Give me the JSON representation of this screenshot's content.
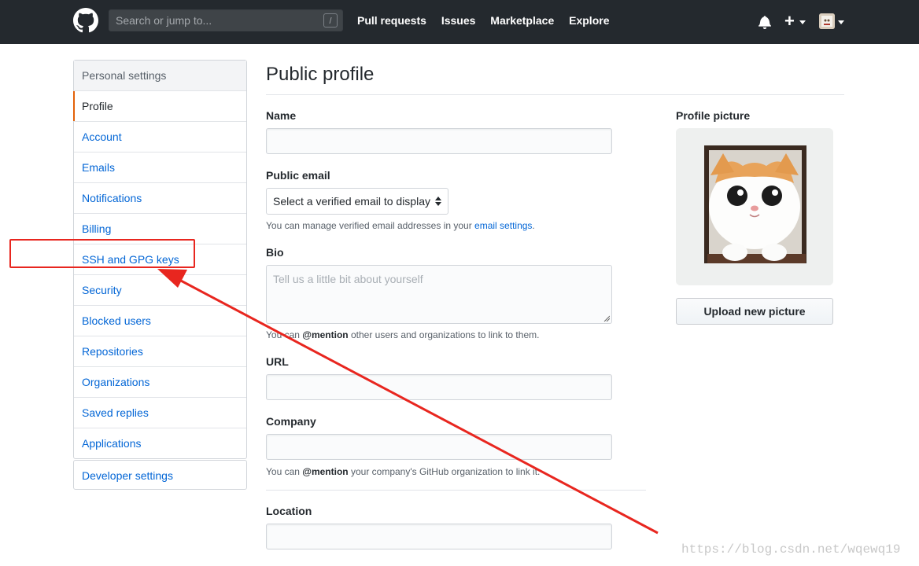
{
  "header": {
    "search_placeholder": "Search or jump to...",
    "search_shortcut": "/",
    "nav": [
      "Pull requests",
      "Issues",
      "Marketplace",
      "Explore"
    ]
  },
  "sidebar": {
    "heading": "Personal settings",
    "items": [
      {
        "label": "Profile",
        "active": true
      },
      {
        "label": "Account"
      },
      {
        "label": "Emails"
      },
      {
        "label": "Notifications"
      },
      {
        "label": "Billing"
      },
      {
        "label": "SSH and GPG keys"
      },
      {
        "label": "Security"
      },
      {
        "label": "Blocked users"
      },
      {
        "label": "Repositories"
      },
      {
        "label": "Organizations"
      },
      {
        "label": "Saved replies"
      },
      {
        "label": "Applications"
      }
    ],
    "developer_settings": "Developer settings"
  },
  "main": {
    "title": "Public profile",
    "name_label": "Name",
    "name_value": "",
    "email_label": "Public email",
    "email_select": "Select a verified email to display",
    "email_note_prefix": "You can manage verified email addresses in your ",
    "email_note_link": "email settings",
    "email_note_suffix": ".",
    "bio_label": "Bio",
    "bio_placeholder": "Tell us a little bit about yourself",
    "bio_note_prefix": "You can ",
    "bio_note_mention": "@mention",
    "bio_note_suffix": " other users and organizations to link to them.",
    "url_label": "URL",
    "url_value": "",
    "company_label": "Company",
    "company_value": "",
    "company_note_prefix": "You can ",
    "company_note_mention": "@mention",
    "company_note_suffix": " your company's GitHub organization to link it.",
    "location_label": "Location",
    "location_value": ""
  },
  "profile_picture": {
    "label": "Profile picture",
    "upload_button": "Upload new picture"
  },
  "annotation": {
    "highlight_color": "#e8261f",
    "watermark": "https://blog.csdn.net/wqewq19"
  },
  "colors": {
    "header_bg": "#24292e",
    "link": "#0366d6",
    "active_indicator": "#e36209"
  }
}
